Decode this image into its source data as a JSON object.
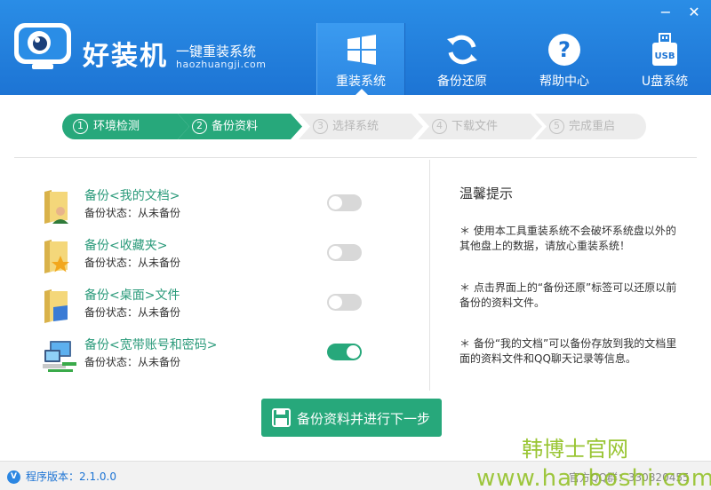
{
  "app": {
    "brand_title": "好装机",
    "slogan": "一键重装系统",
    "url": "haozhuangji.com"
  },
  "window_controls": {
    "minimize": "−",
    "close": "✕"
  },
  "nav": [
    {
      "label": "重装系统",
      "icon": "windows-icon",
      "active": true
    },
    {
      "label": "备份还原",
      "icon": "sync-icon",
      "active": false
    },
    {
      "label": "帮助中心",
      "icon": "help-icon",
      "active": false
    },
    {
      "label": "U盘系统",
      "icon": "usb-icon",
      "active": false
    }
  ],
  "usb_icon_text": "USB",
  "steps": [
    {
      "num": "1",
      "label": "环境检测",
      "state": "done"
    },
    {
      "num": "2",
      "label": "备份资料",
      "state": "current"
    },
    {
      "num": "3",
      "label": "选择系统",
      "state": "pending"
    },
    {
      "num": "4",
      "label": "下载文件",
      "state": "pending"
    },
    {
      "num": "5",
      "label": "完成重启",
      "state": "pending"
    }
  ],
  "backup_items": [
    {
      "title": "备份<我的文档>",
      "status": "备份状态：从未备份",
      "icon": "my-documents-folder-icon",
      "enabled": false
    },
    {
      "title": "备份<收藏夹>",
      "status": "备份状态：从未备份",
      "icon": "favorites-folder-icon",
      "enabled": false
    },
    {
      "title": "备份<桌面>文件",
      "status": "备份状态：从未备份",
      "icon": "desktop-folder-icon",
      "enabled": false
    },
    {
      "title": "备份<宽带账号和密码>",
      "status": "备份状态：从未备份",
      "icon": "network-computer-icon",
      "enabled": true
    }
  ],
  "tips": {
    "title": "温馨提示",
    "items": [
      "＊ 使用本工具重装系统不会破坏系统盘以外的其他盘上的数据，请放心重装系统！",
      "＊ 点击界面上的“备份还原”标签可以还原以前备份的资料文件。",
      "＊ 备份“我的文档”可以备份存放到我的文档里面的资料文件和QQ聊天记录等信息。"
    ]
  },
  "next_button": "备份资料并进行下一步",
  "footer": {
    "version_badge": "V",
    "version": "程序版本：2.1.0.0",
    "qq": "官方QQ群：330820455"
  },
  "watermark": {
    "line1": "韩博士官网",
    "line2": "www.hanboshi.com"
  },
  "colors": {
    "header_blue": "#1d74d4",
    "accent_green": "#27a87b",
    "watermark_green": "#8fbf1e"
  }
}
